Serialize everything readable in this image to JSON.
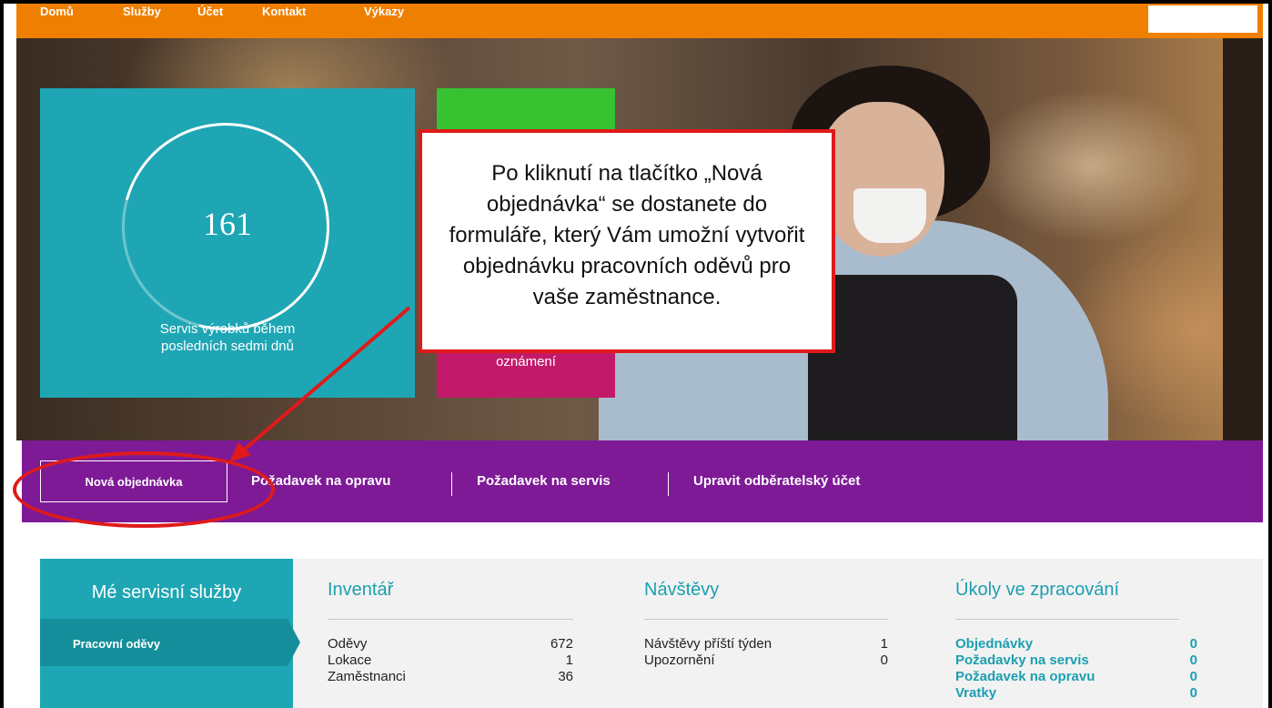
{
  "nav": {
    "items": [
      "Domů",
      "Služby",
      "Účet",
      "Kontakt",
      "Výkazy"
    ]
  },
  "hero": {
    "teal_tile": {
      "value": "161",
      "caption": "Servis výrobků během posledních sedmi dnů"
    },
    "pink_tile": {
      "label": "oznámení"
    }
  },
  "callout": {
    "text": "Po kliknutí na tlačítko „Nová objednávka“ se dostanete do formuláře, který Vám umožní vytvořit objednávku pracovních oděvů pro vaše zaměstnance."
  },
  "actions": {
    "new_order": "Nová objednávka",
    "repair_request": "Požadavek na opravu",
    "service_request": "Požadavek na servis",
    "edit_account": "Upravit odběratelský účet"
  },
  "services": {
    "title": "Mé servisní služby",
    "tab": "Pracovní oděvy"
  },
  "inventory": {
    "title": "Inventář",
    "rows": [
      {
        "label": "Oděvy",
        "value": "672"
      },
      {
        "label": "Lokace",
        "value": "1"
      },
      {
        "label": "Zaměstnanci",
        "value": "36"
      }
    ]
  },
  "visits": {
    "title": "Návštěvy",
    "rows": [
      {
        "label": "Návštěvy příští týden",
        "value": "1"
      },
      {
        "label": "Upozornění",
        "value": "0"
      }
    ]
  },
  "tasks": {
    "title": "Úkoly ve zpracování",
    "rows": [
      {
        "label": "Objednávky",
        "value": "0"
      },
      {
        "label": "Požadavky na servis",
        "value": "0"
      },
      {
        "label": "Požadavek na opravu",
        "value": "0"
      },
      {
        "label": "Vratky",
        "value": "0"
      }
    ]
  },
  "colors": {
    "nav": "#ef7f00",
    "teal": "#1fa6b4",
    "green": "#36c231",
    "pink": "#c3196a",
    "purple": "#7e1a96",
    "annotation": "#e01a1a"
  }
}
